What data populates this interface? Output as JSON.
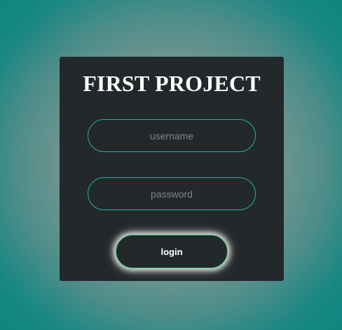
{
  "card": {
    "title": "FIRST PROJECT"
  },
  "form": {
    "username": {
      "value": "",
      "placeholder": "username"
    },
    "password": {
      "value": "",
      "placeholder": "password"
    },
    "login_label": "login"
  },
  "colors": {
    "card_bg": "#23282a",
    "field_border": "#1fb5a8",
    "button_border": "#2ecc71",
    "background_teal": "#0f8580"
  }
}
